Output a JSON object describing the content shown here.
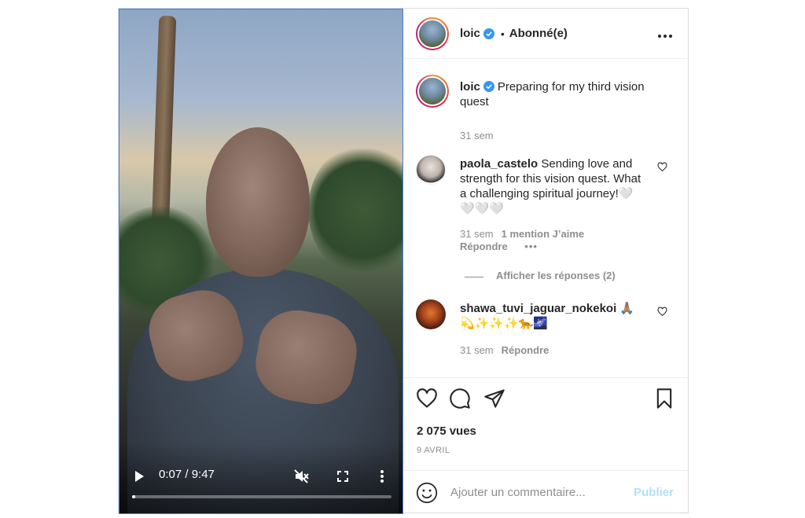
{
  "post": {
    "author": {
      "username": "loic",
      "follow_status": "Abonné(e)",
      "separator": "•",
      "more_icon": "more-horizontal-icon"
    },
    "video": {
      "current_time": "0:07",
      "duration": "9:47",
      "time_display": "0:07 / 9:47",
      "progress_fraction": 0.012,
      "icons": [
        "play-icon",
        "mute-icon",
        "fullscreen-icon",
        "more-vertical-icon"
      ]
    },
    "caption": {
      "username": "loic",
      "text": "Preparing for my third vision quest",
      "age": "31 sem"
    },
    "comments": [
      {
        "username": "paola_castelo",
        "text": "Sending love and strength for this vision quest. What a challenging spiritual journey!🤍🤍🤍🤍",
        "age": "31 sem",
        "likes": "1 mention J’aime",
        "reply": "Répondre",
        "more": "•••",
        "view_replies": "Afficher les réponses (2)"
      },
      {
        "username": "shawa_tuvi_jaguar_nokekoi",
        "text": "🙏🏽💫✨✨✨🐆🌌",
        "age": "31 sem",
        "reply": "Répondre"
      }
    ],
    "stats": {
      "views": "2 075 vues",
      "date": "9 AVRIL"
    },
    "composer": {
      "placeholder": "Ajouter un commentaire...",
      "publish_label": "Publier"
    },
    "colors": {
      "verified": "#3897f0",
      "publish_disabled": "#b2dffc",
      "meta_gray": "#8e8e8e",
      "focus_border": "#3f7ee6"
    }
  }
}
